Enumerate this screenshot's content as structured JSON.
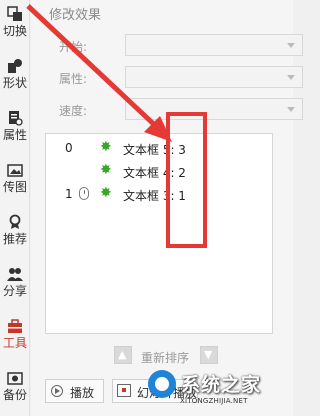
{
  "sidebar": {
    "items": [
      {
        "label": "切换",
        "icon": "switch-icon"
      },
      {
        "label": "形状",
        "icon": "shape-icon"
      },
      {
        "label": "属性",
        "icon": "properties-icon"
      },
      {
        "label": "传图",
        "icon": "upload-image-icon"
      },
      {
        "label": "推荐",
        "icon": "recommend-icon"
      },
      {
        "label": "分享",
        "icon": "share-icon"
      },
      {
        "label": "工具",
        "icon": "toolbox-icon"
      },
      {
        "label": "备份",
        "icon": "backup-icon"
      }
    ]
  },
  "panel": {
    "section_title": "修改效果",
    "fields": {
      "start_label": "开始:",
      "property_label": "属性:",
      "speed_label": "速度:"
    }
  },
  "animation_list": [
    {
      "order": "0",
      "trigger": "",
      "name": "文本框 5: 3"
    },
    {
      "order": "",
      "trigger": "",
      "name": "文本框 4: 2"
    },
    {
      "order": "1",
      "trigger": "mouse-click",
      "name": "文本框 3: 1"
    }
  ],
  "reorder": {
    "label": "重新排序"
  },
  "buttons": {
    "play": "播放",
    "slideshow": "幻灯片播放"
  },
  "watermark": {
    "title": "系统之家",
    "url": "XITONGZHIJIA.NET"
  },
  "colors": {
    "accent_red": "#e53935",
    "effect_star": "#3aa52b",
    "watermark_blue": "#1f84d8"
  }
}
